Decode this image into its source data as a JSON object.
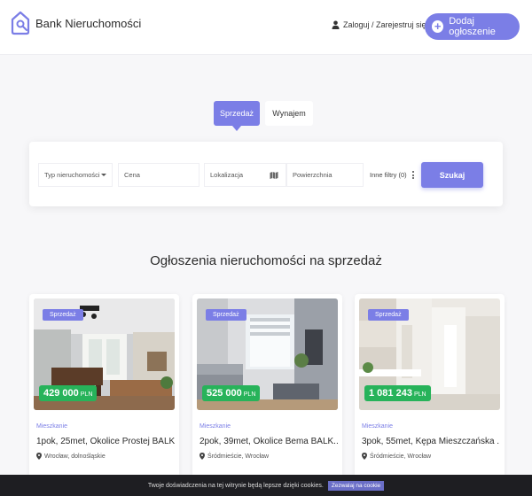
{
  "header": {
    "brand": "Bank Nieruchomości",
    "login_label": "Zaloguj / Zarejestruj się",
    "add_listing_label": "Dodaj ogłoszenie"
  },
  "tabs": [
    {
      "label": "Sprzedaż",
      "active": true
    },
    {
      "label": "Wynajem",
      "active": false
    }
  ],
  "search": {
    "type_placeholder": "Typ nieruchomości",
    "price_placeholder": "Cena",
    "location_placeholder": "Lokalizacja",
    "area_placeholder": "Powierzchnia",
    "filters_label": "Inne filtry (0)",
    "submit_label": "Szukaj"
  },
  "section_title": "Ogłoszenia nieruchomości na sprzedaż",
  "listings": [
    {
      "badge": "Sprzedaż",
      "price": "429 000",
      "currency": "PLN",
      "type": "Mieszkanie",
      "title": "1pok, 25met, Okolice Prostej BALK...",
      "location": "Wrocław, dolnośląskie"
    },
    {
      "badge": "Sprzedaż",
      "price": "525 000",
      "currency": "PLN",
      "type": "Mieszkanie",
      "title": "2pok, 39met, Okolice Bema BALK...",
      "location": "Śródmieście, Wrocław"
    },
    {
      "badge": "Sprzedaż",
      "price": "1 081 243",
      "currency": "PLN",
      "type": "Mieszkanie",
      "title": "3pok, 55met, Kępa Mieszczańska ...",
      "location": "Śródmieście, Wrocław"
    }
  ],
  "cookie": {
    "text": "Twoje doświadczenia na tej witrynie będą lepsze dzięki cookies.",
    "accept_label": "Zezwalaj na cookie"
  },
  "colors": {
    "accent": "#7b7ee6",
    "price_badge": "#27b35a",
    "cookie_bar": "#1e1e22"
  }
}
